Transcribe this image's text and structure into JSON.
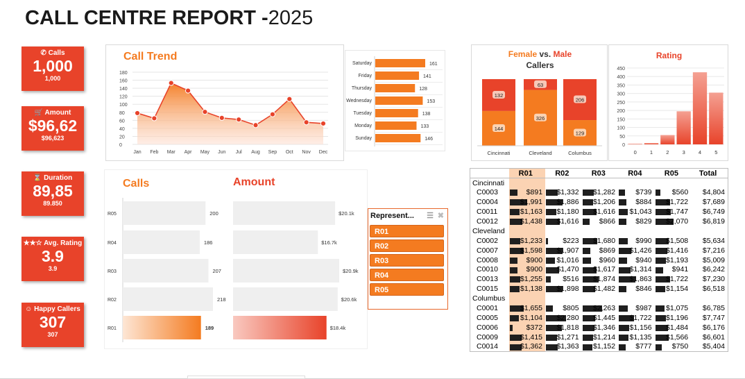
{
  "title": {
    "bold": "CALL CENTRE REPORT -",
    "year": "2025"
  },
  "kpis": {
    "calls": {
      "label": "Calls",
      "value": "1,000",
      "sub": "1,000"
    },
    "amount": {
      "label": "Amount",
      "value": "$96,62",
      "sub": "$96,623"
    },
    "duration": {
      "label": "Duration",
      "value": "89,85",
      "sub": "89.850"
    },
    "rating": {
      "label": "Avg. Rating",
      "value": "3.9",
      "sub": "3.9"
    },
    "happy": {
      "label": "Happy Callers",
      "value": "307",
      "sub": "307"
    }
  },
  "charts": {
    "call_trend": {
      "title": "Call Trend",
      "type": "area",
      "categories": [
        "Jan",
        "Feb",
        "Mar",
        "Apr",
        "May",
        "Jun",
        "Jul",
        "Aug",
        "Sep",
        "Oct",
        "Nov",
        "Dec"
      ],
      "values": [
        78,
        65,
        153,
        134,
        81,
        66,
        62,
        48,
        75,
        113,
        55,
        52
      ],
      "ylim": [
        0,
        180
      ],
      "yticks": [
        "0",
        "20",
        "40",
        "60",
        "80",
        "100",
        "120",
        "140",
        "160",
        "180"
      ]
    },
    "weekday": {
      "type": "bar",
      "categories": [
        "Saturday",
        "Friday",
        "Thursday",
        "Wednesday",
        "Tuesday",
        "Monday",
        "Sunday"
      ],
      "category_labels": [
        "Saturday",
        "Friday",
        "Thursday",
        "Wednesday",
        "Tuesday",
        "Monday",
        "Sunday"
      ],
      "values": [
        161,
        141,
        128,
        153,
        138,
        133,
        146
      ]
    },
    "gender": {
      "title_female": "Female",
      "title_vs": " vs. ",
      "title_male": "Male",
      "title_line2": "Callers",
      "type": "bar",
      "categories": [
        "Cincinnati",
        "Cleveland",
        "Columbus"
      ],
      "series": [
        {
          "values": [
            144,
            326,
            129
          ]
        },
        {
          "values": [
            132,
            63,
            206
          ]
        }
      ]
    },
    "rating": {
      "title": "Rating",
      "type": "bar",
      "categories": [
        "0",
        "1",
        "2",
        "3",
        "4",
        "5"
      ],
      "values": [
        3,
        8,
        55,
        195,
        425,
        305
      ],
      "ylim": [
        0,
        450
      ],
      "yticks": [
        "0",
        "50",
        "100",
        "150",
        "200",
        "250",
        "300",
        "350",
        "400",
        "450"
      ]
    },
    "rep_calls": {
      "title": "Calls",
      "type": "bar",
      "categories": [
        "R05",
        "R04",
        "R03",
        "R02",
        "R01"
      ],
      "values": [
        200,
        186,
        207,
        218,
        189
      ],
      "value_labels": [
        "200",
        "186",
        "207",
        "218",
        "189"
      ]
    },
    "rep_amount": {
      "title": "Amount",
      "type": "bar",
      "categories": [
        "R05",
        "R04",
        "R03",
        "R02",
        "R01"
      ],
      "values": [
        20.1,
        16.7,
        20.9,
        20.6,
        18.4
      ],
      "value_labels": [
        "$20.1k",
        "$16.7k",
        "$20.9k",
        "$20.6k",
        "$18.4k"
      ]
    }
  },
  "slicer": {
    "header": "Represent...",
    "items": [
      "R01",
      "R02",
      "R03",
      "R04",
      "R05"
    ]
  },
  "table": {
    "headers": [
      "",
      "R01",
      "R02",
      "R03",
      "R04",
      "R05",
      "Total"
    ],
    "groups": [
      {
        "name": "Cincinnati",
        "rows": [
          {
            "id": "C0003",
            "cells": [
              "$891",
              "$1,332",
              "$1,282",
              "$739",
              "$560",
              "$4,804"
            ],
            "vals": [
              891,
              1332,
              1282,
              739,
              560
            ]
          },
          {
            "id": "C0004",
            "cells": [
              "$1,991",
              "$1,886",
              "$1,206",
              "$884",
              "$1,722",
              "$7,689"
            ],
            "vals": [
              1991,
              1886,
              1206,
              884,
              1722
            ]
          },
          {
            "id": "C0011",
            "cells": [
              "$1,163",
              "$1,180",
              "$1,616",
              "$1,043",
              "$1,747",
              "$6,749"
            ],
            "vals": [
              1163,
              1180,
              1616,
              1043,
              1747
            ]
          },
          {
            "id": "C0012",
            "cells": [
              "$1,438",
              "$1,616",
              "$866",
              "$829",
              "$2,070",
              "$6,819"
            ],
            "vals": [
              1438,
              1616,
              866,
              829,
              2070
            ]
          }
        ]
      },
      {
        "name": "Cleveland",
        "rows": [
          {
            "id": "C0002",
            "cells": [
              "$1,233",
              "$223",
              "$1,680",
              "$990",
              "$1,508",
              "$5,634"
            ],
            "vals": [
              1233,
              223,
              1680,
              990,
              1508
            ]
          },
          {
            "id": "C0007",
            "cells": [
              "$1,598",
              "$1,907",
              "$869",
              "$1,426",
              "$1,416",
              "$7,216"
            ],
            "vals": [
              1598,
              1907,
              869,
              1426,
              1416
            ]
          },
          {
            "id": "C0008",
            "cells": [
              "$900",
              "$1,016",
              "$960",
              "$940",
              "$1,193",
              "$5,009"
            ],
            "vals": [
              900,
              1016,
              960,
              940,
              1193
            ]
          },
          {
            "id": "C0010",
            "cells": [
              "$900",
              "$1,470",
              "$1,617",
              "$1,314",
              "$941",
              "$6,242"
            ],
            "vals": [
              900,
              1470,
              1617,
              1314,
              941
            ]
          },
          {
            "id": "C0013",
            "cells": [
              "$1,255",
              "$516",
              "$1,874",
              "$1,863",
              "$1,722",
              "$7,230"
            ],
            "vals": [
              1255,
              516,
              1874,
              1863,
              1722
            ]
          },
          {
            "id": "C0015",
            "cells": [
              "$1,138",
              "$1,898",
              "$1,482",
              "$846",
              "$1,154",
              "$6,518"
            ],
            "vals": [
              1138,
              1898,
              1482,
              846,
              1154
            ]
          }
        ]
      },
      {
        "name": "Columbus",
        "rows": [
          {
            "id": "C0001",
            "cells": [
              "$1,655",
              "$805",
              "$2,263",
              "$987",
              "$1,075",
              "$6,785"
            ],
            "vals": [
              1655,
              805,
              2263,
              987,
              1075
            ]
          },
          {
            "id": "C0005",
            "cells": [
              "$1,104",
              "$2,280",
              "$1,445",
              "$1,722",
              "$1,196",
              "$7,747"
            ],
            "vals": [
              1104,
              2280,
              1445,
              1722,
              1196
            ]
          },
          {
            "id": "C0006",
            "cells": [
              "$372",
              "$1,818",
              "$1,346",
              "$1,156",
              "$1,484",
              "$6,176"
            ],
            "vals": [
              372,
              1818,
              1346,
              1156,
              1484
            ]
          },
          {
            "id": "C0009",
            "cells": [
              "$1,415",
              "$1,271",
              "$1,214",
              "$1,135",
              "$1,566",
              "$6,601"
            ],
            "vals": [
              1415,
              1271,
              1214,
              1135,
              1566
            ]
          },
          {
            "id": "C0014",
            "cells": [
              "$1,362",
              "$1,363",
              "$1,152",
              "$777",
              "$750",
              "$5,404"
            ],
            "vals": [
              1362,
              1363,
              1152,
              777,
              750
            ]
          }
        ]
      }
    ]
  },
  "colors": {
    "orange": "#f47b20",
    "red": "#e8432a",
    "light_orange": "#fbd3b3"
  },
  "icons": {
    "calls": "phone-icon",
    "amount": "cart-icon",
    "duration": "hourglass-icon",
    "rating": "stars-icon",
    "happy": "smiley-icon",
    "slicer_multiselect": "multiselect-icon",
    "slicer_clear": "clear-filter-icon"
  }
}
